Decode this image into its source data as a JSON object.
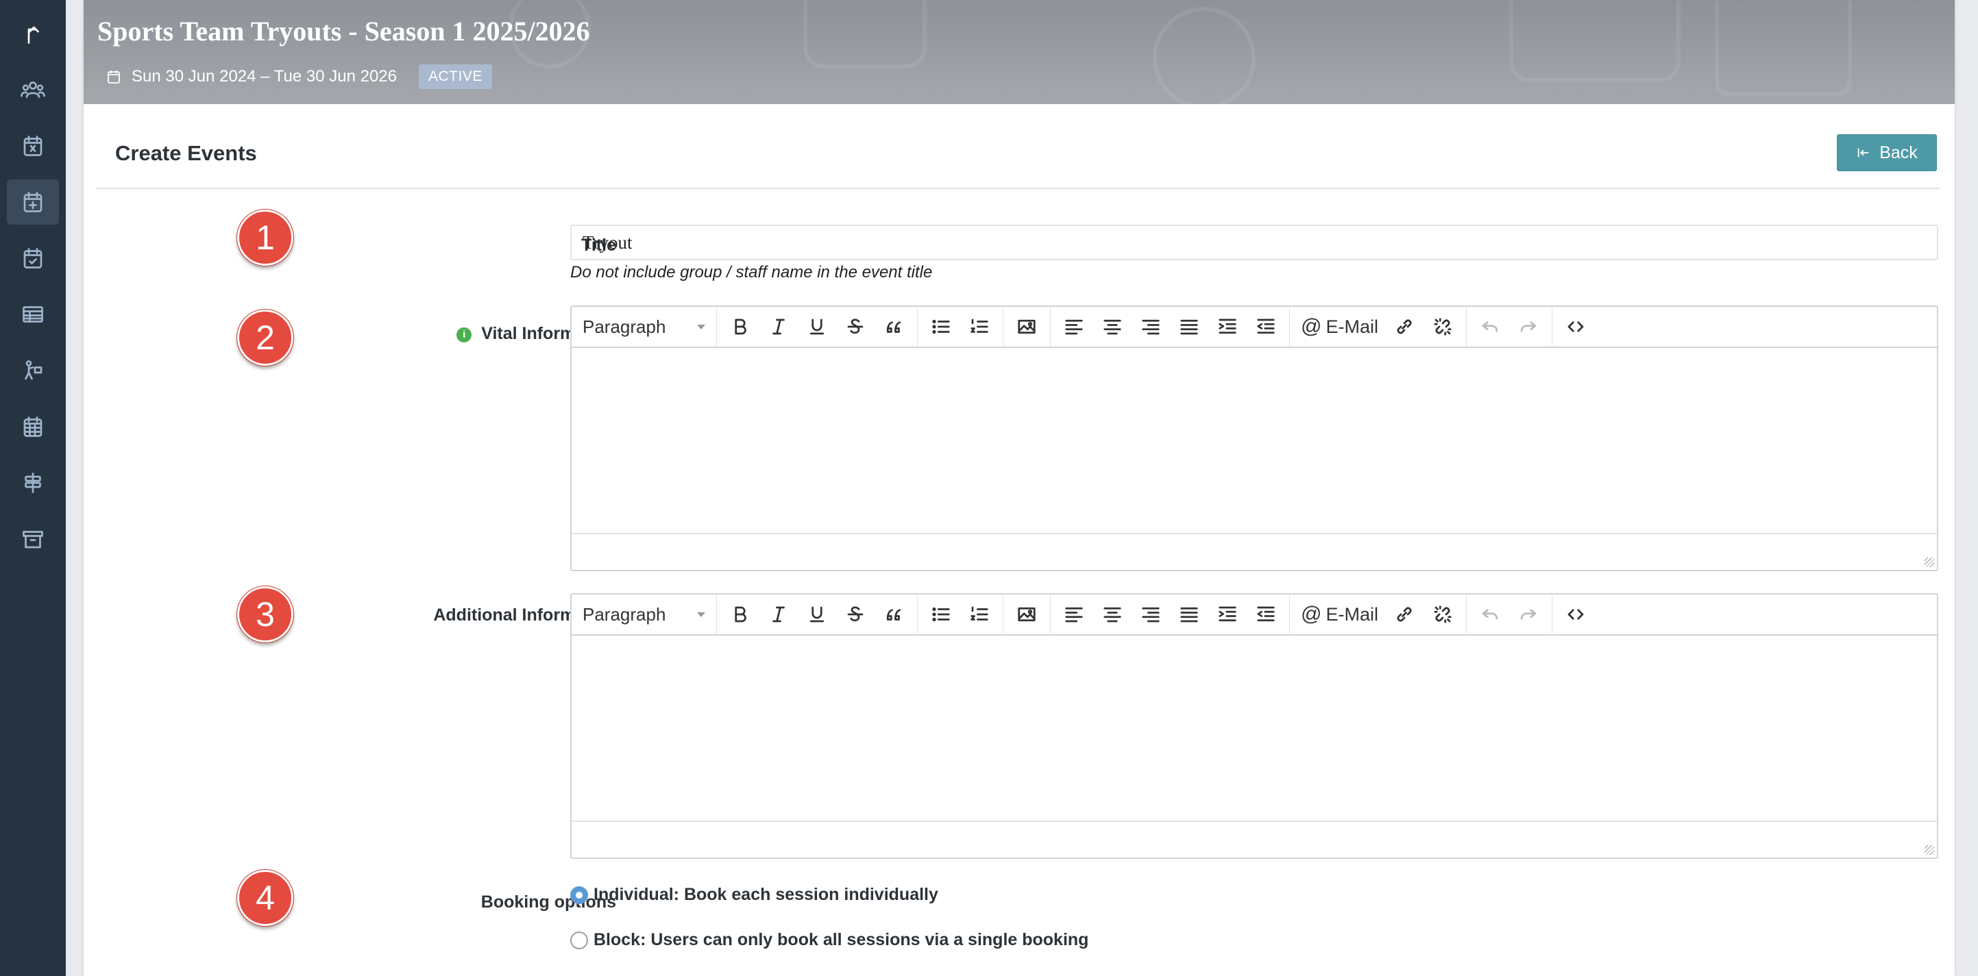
{
  "sidebar": {
    "items": [
      {
        "icon": "arrow-up-icon",
        "active": false
      },
      {
        "icon": "users-icon",
        "active": false
      },
      {
        "icon": "calendar-x-icon",
        "active": false
      },
      {
        "icon": "calendar-plus-icon",
        "active": true
      },
      {
        "icon": "calendar-check-icon",
        "active": false
      },
      {
        "icon": "table-icon",
        "active": false
      },
      {
        "icon": "person-activity-icon",
        "active": false
      },
      {
        "icon": "calendar-grid-icon",
        "active": false
      },
      {
        "icon": "signpost-icon",
        "active": false
      },
      {
        "icon": "archive-icon",
        "active": false
      }
    ]
  },
  "banner": {
    "title": "Sports Team Tryouts - Season 1 2025/2026",
    "dates": "Sun 30 Jun 2024 – Tue 30 Jun 2026",
    "status": "ACTIVE"
  },
  "page": {
    "title": "Create Events",
    "back_label": "Back"
  },
  "form": {
    "steps": [
      "1",
      "2",
      "3",
      "4"
    ],
    "title_label": "Title",
    "title_value": "Tryout",
    "title_hint": "Do not include group / staff name in the event title",
    "vital_label": "Vital Information",
    "additional_label": "Additional Information",
    "booking_label": "Booking options",
    "booking_options": [
      {
        "label": "Individual: Book each session individually",
        "selected": true
      },
      {
        "label": "Block: Users can only book all sessions via a single booking",
        "selected": false
      }
    ]
  },
  "editor": {
    "format_select": "Paragraph",
    "email_label": "E-Mail"
  },
  "colors": {
    "sidebar": "#263442",
    "accent": "#4d9aa6",
    "step_badge": "#e44a3e"
  }
}
